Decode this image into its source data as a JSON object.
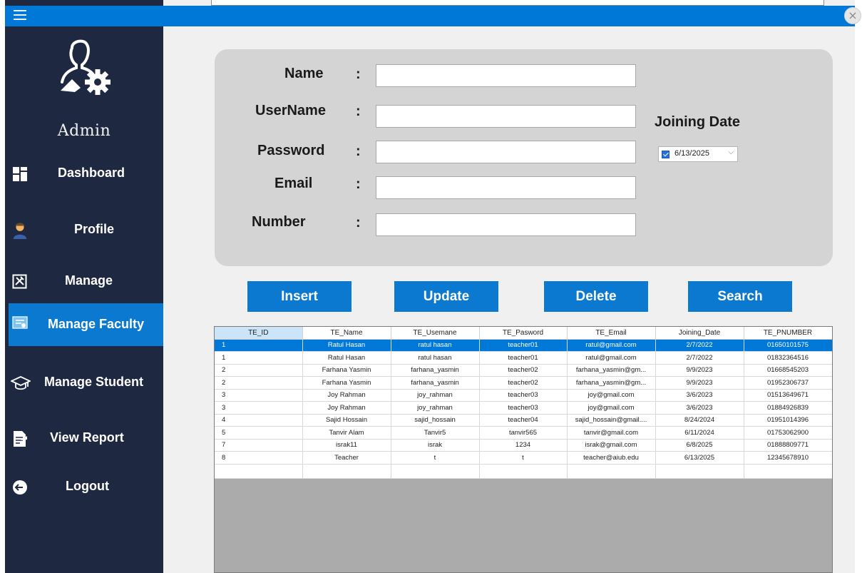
{
  "sidebar": {
    "admin_label": "Admin",
    "items": [
      {
        "label": "Dashboard",
        "icon": "dashboard-icon"
      },
      {
        "label": "Profile",
        "icon": "profile-icon"
      },
      {
        "label": "Manage",
        "icon": "manage-icon"
      },
      {
        "label": "Manage Faculty",
        "icon": "manage-faculty-icon",
        "active": true
      },
      {
        "label": "Manage Student",
        "icon": "graduation-cap-icon"
      },
      {
        "label": "View Report",
        "icon": "report-icon"
      },
      {
        "label": "Logout",
        "icon": "logout-icon"
      }
    ]
  },
  "topbar": {
    "close_glyph": "×"
  },
  "form": {
    "name_label": "Name",
    "username_label": "UserName",
    "password_label": "Password",
    "email_label": "Email",
    "number_label": "Number",
    "colon": ":",
    "name_value": "",
    "username_value": "",
    "password_value": "",
    "email_value": "",
    "number_value": "",
    "joining_date_label": "Joining Date",
    "joining_date_value": "6/13/2025",
    "joining_date_checked": true
  },
  "buttons": {
    "insert": "Insert",
    "update": "Update",
    "delete": "Delete",
    "search": "Search"
  },
  "grid": {
    "columns": [
      "TE_ID",
      "TE_Name",
      "TE_Usemane",
      "TE_Pasword",
      "TE_Email",
      "Joining_Date",
      "TE_PNUMBER"
    ],
    "rows": [
      [
        "1",
        "Ratul Hasan",
        "ratul hasan",
        "teacher01",
        "ratul@gmail.com",
        "2/7/2022",
        "01650101575"
      ],
      [
        "1",
        "Ratul Hasan",
        "ratul hasan",
        "teacher01",
        "ratul@gmail.com",
        "2/7/2022",
        "01832364516"
      ],
      [
        "2",
        "Farhana Yasmin",
        "farhana_yasmin",
        "teacher02",
        "farhana_yasmin@gm...",
        "9/9/2023",
        "01668545203"
      ],
      [
        "2",
        "Farhana Yasmin",
        "farhana_yasmin",
        "teacher02",
        "farhana_yasmin@gm...",
        "9/9/2023",
        "01952306737"
      ],
      [
        "3",
        "Joy Rahman",
        "joy_rahman",
        "teacher03",
        "joy@gmail.com",
        "3/6/2023",
        "01513649671"
      ],
      [
        "3",
        "Joy Rahman",
        "joy_rahman",
        "teacher03",
        "joy@gmail.com",
        "3/6/2023",
        "01884926839"
      ],
      [
        "4",
        "Sajid Hossain",
        "sajid_hossain",
        "teacher04",
        "sajid_hossain@gmail....",
        "8/24/2024",
        "01951014396"
      ],
      [
        "5",
        "Tanvir Alam",
        "Tanvir5",
        "tanvir565",
        "tanvir@gmail.com",
        "6/11/2024",
        "01753062900"
      ],
      [
        "7",
        "israk11",
        "israk",
        "1234",
        "israk@gmail.com",
        "6/8/2025",
        "01888809771"
      ],
      [
        "8",
        "Teacher",
        "t",
        "t",
        "teacher@aiub.edu",
        "6/13/2025",
        "12345678910"
      ]
    ],
    "selected_row": 0
  }
}
